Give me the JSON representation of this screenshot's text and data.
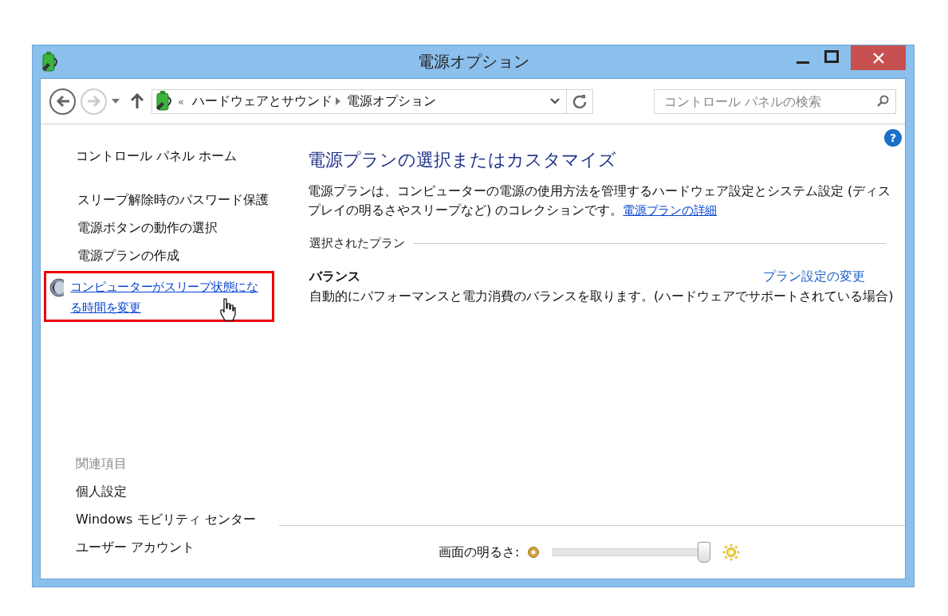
{
  "window": {
    "title": "電源オプション"
  },
  "navigation": {
    "back_enabled": true,
    "forward_enabled": false,
    "address_overflow": "«",
    "breadcrumbs": [
      "ハードウェアとサウンド",
      "電源オプション"
    ],
    "search": {
      "placeholder": "コントロール パネルの検索"
    }
  },
  "sidebar": {
    "home": "コントロール パネル ホーム",
    "tasks": [
      {
        "label": "スリープ解除時のパスワード保護",
        "kind": "plain",
        "highlighted": false
      },
      {
        "label": "電源ボタンの動作の選択",
        "kind": "plain",
        "highlighted": false
      },
      {
        "label": "電源プランの作成",
        "kind": "plain",
        "highlighted": false
      },
      {
        "label": "コンピューターがスリープ状態になる時間を変更",
        "kind": "moon",
        "highlighted": true
      }
    ],
    "related_heading": "関連項目",
    "related": [
      "個人設定",
      "Windows モビリティ センター",
      "ユーザー アカウント"
    ]
  },
  "main": {
    "heading": "電源プランの選択またはカスタマイズ",
    "description": "電源プランは、コンピューターの電源の使用方法を管理するハードウェア設定とシステム設定 (ディスプレイの明るさやスリープなど) のコレクションです。",
    "description_link": "電源プランの詳細",
    "section_label": "選択されたプラン",
    "plan": {
      "name": "バランス",
      "change_link": "プラン設定の変更",
      "description": "自動的にパフォーマンスと電力消費のバランスを取ります。(ハードウェアでサポートされている場合)"
    }
  },
  "brightness": {
    "label": "画面の明るさ:",
    "level": 1.0
  },
  "help_glyph": "?"
}
